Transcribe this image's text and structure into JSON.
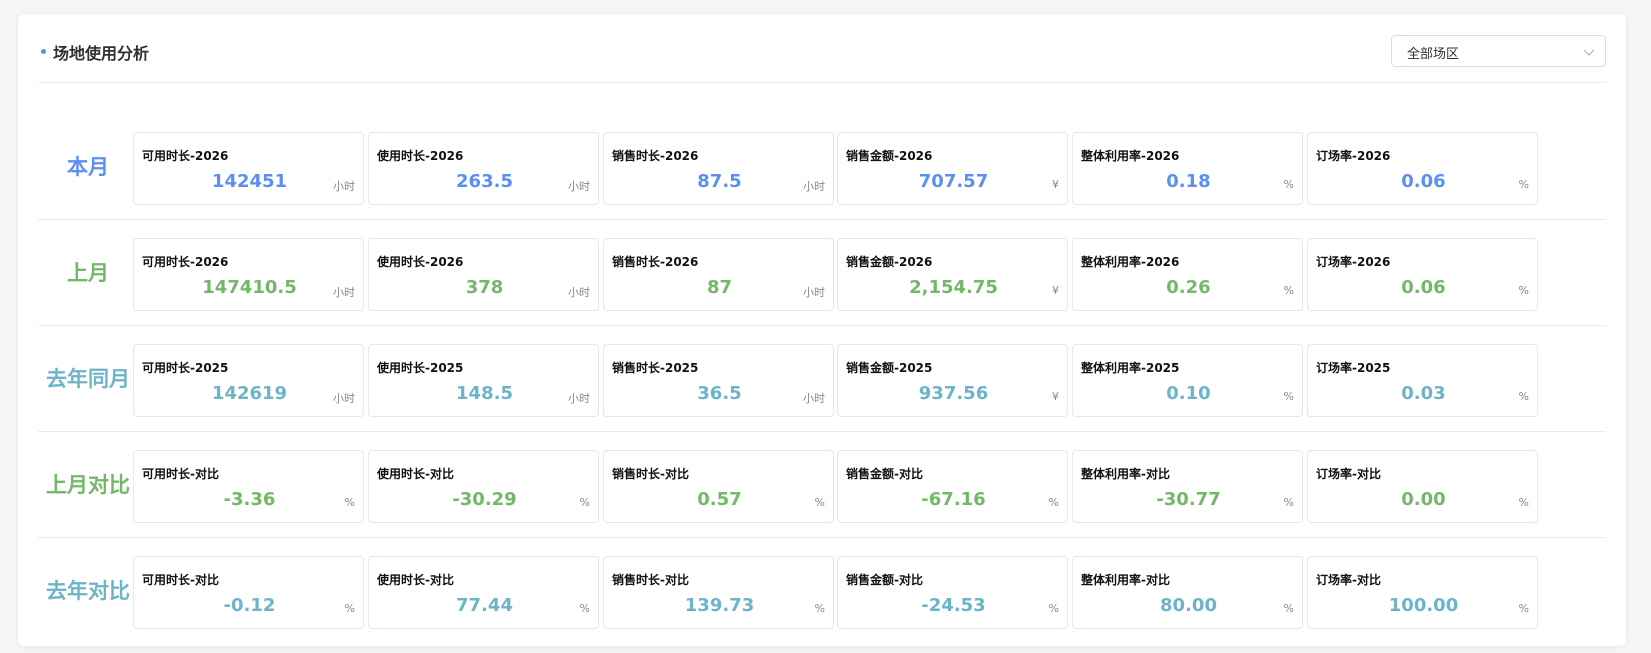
{
  "header": {
    "title": "场地使用分析",
    "zone_select": "全部场区"
  },
  "colors": {
    "blue": "#5b8ff2",
    "green": "#73b868",
    "teal": "#6cb4c8"
  },
  "rows": [
    {
      "label": "本月",
      "color": "blue",
      "cards": [
        {
          "label": "可用时长-2026",
          "value": "142451",
          "unit": "小时"
        },
        {
          "label": "使用时长-2026",
          "value": "263.5",
          "unit": "小时"
        },
        {
          "label": "销售时长-2026",
          "value": "87.5",
          "unit": "小时"
        },
        {
          "label": "销售金额-2026",
          "value": "707.57",
          "unit": "¥"
        },
        {
          "label": "整体利用率-2026",
          "value": "0.18",
          "unit": "%"
        },
        {
          "label": "订场率-2026",
          "value": "0.06",
          "unit": "%"
        }
      ]
    },
    {
      "label": "上月",
      "color": "green",
      "cards": [
        {
          "label": "可用时长-2026",
          "value": "147410.5",
          "unit": "小时"
        },
        {
          "label": "使用时长-2026",
          "value": "378",
          "unit": "小时"
        },
        {
          "label": "销售时长-2026",
          "value": "87",
          "unit": "小时"
        },
        {
          "label": "销售金额-2026",
          "value": "2,154.75",
          "unit": "¥"
        },
        {
          "label": "整体利用率-2026",
          "value": "0.26",
          "unit": "%"
        },
        {
          "label": "订场率-2026",
          "value": "0.06",
          "unit": "%"
        }
      ]
    },
    {
      "label": "去年同月",
      "color": "teal",
      "cards": [
        {
          "label": "可用时长-2025",
          "value": "142619",
          "unit": "小时"
        },
        {
          "label": "使用时长-2025",
          "value": "148.5",
          "unit": "小时"
        },
        {
          "label": "销售时长-2025",
          "value": "36.5",
          "unit": "小时"
        },
        {
          "label": "销售金额-2025",
          "value": "937.56",
          "unit": "¥"
        },
        {
          "label": "整体利用率-2025",
          "value": "0.10",
          "unit": "%"
        },
        {
          "label": "订场率-2025",
          "value": "0.03",
          "unit": "%"
        }
      ]
    },
    {
      "label": "上月对比",
      "color": "green",
      "cards": [
        {
          "label": "可用时长-对比",
          "value": "-3.36",
          "unit": "%"
        },
        {
          "label": "使用时长-对比",
          "value": "-30.29",
          "unit": "%"
        },
        {
          "label": "销售时长-对比",
          "value": "0.57",
          "unit": "%"
        },
        {
          "label": "销售金额-对比",
          "value": "-67.16",
          "unit": "%"
        },
        {
          "label": "整体利用率-对比",
          "value": "-30.77",
          "unit": "%"
        },
        {
          "label": "订场率-对比",
          "value": "0.00",
          "unit": "%"
        }
      ]
    },
    {
      "label": "去年对比",
      "color": "teal",
      "cards": [
        {
          "label": "可用时长-对比",
          "value": "-0.12",
          "unit": "%"
        },
        {
          "label": "使用时长-对比",
          "value": "77.44",
          "unit": "%"
        },
        {
          "label": "销售时长-对比",
          "value": "139.73",
          "unit": "%"
        },
        {
          "label": "销售金额-对比",
          "value": "-24.53",
          "unit": "%"
        },
        {
          "label": "整体利用率-对比",
          "value": "80.00",
          "unit": "%"
        },
        {
          "label": "订场率-对比",
          "value": "100.00",
          "unit": "%"
        }
      ]
    }
  ]
}
